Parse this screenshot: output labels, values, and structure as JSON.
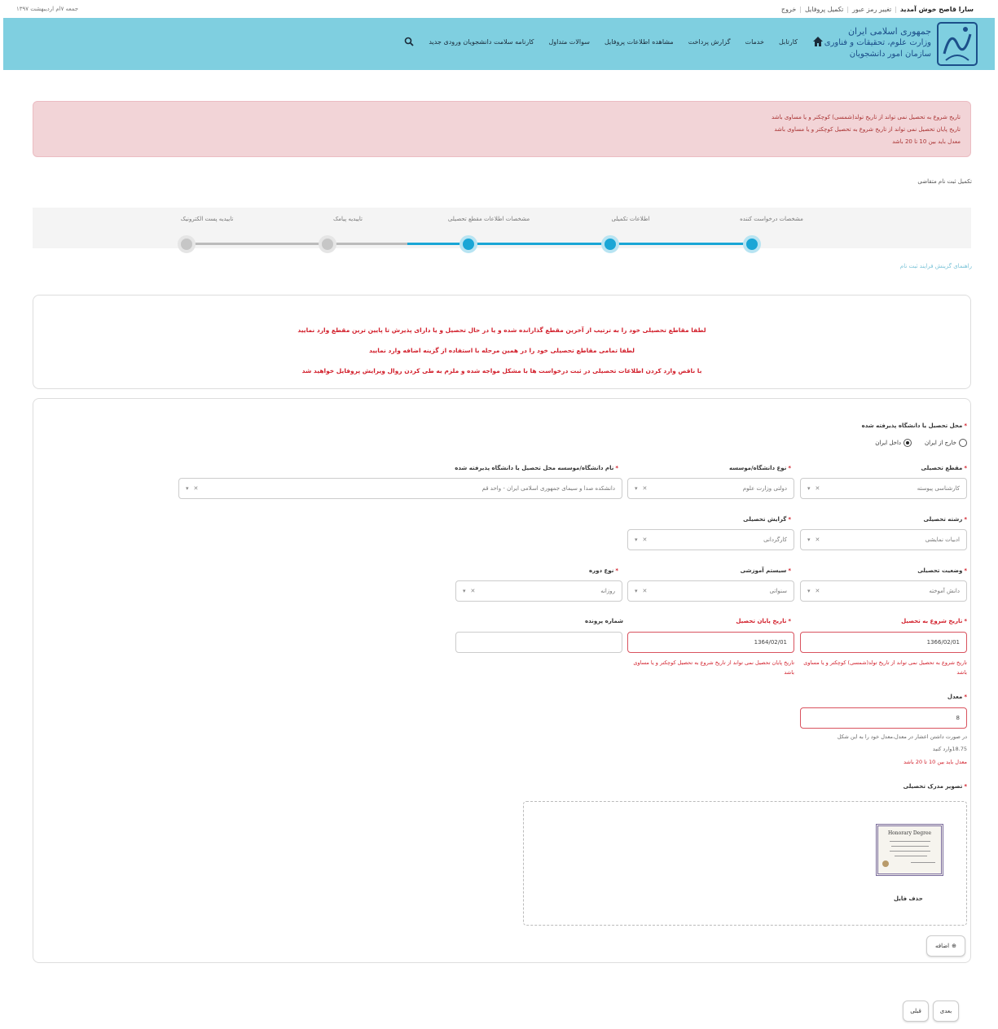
{
  "topbar": {
    "welcome": "سارا قاصح خوش آمدید",
    "change_password": "تغییر رمز عبور",
    "complete_profile": "تکمیل پروفایل",
    "logout": "خروج",
    "date": "جمعه ۷ام اردیبهشت ۱۳۹۷"
  },
  "header": {
    "logo_line1": "جمهوری اسلامی ایران",
    "logo_line2": "وزارت علوم، تحقیقات و فناوری",
    "logo_line3": "سازمان امور دانشجویان",
    "nav": [
      "کارتابل",
      "خدمات",
      "گزارش پرداخت",
      "مشاهده اطلاعات پروفایل",
      "سوالات متداول",
      "کارنامه سلامت دانشجویان ورودی جدید"
    ]
  },
  "alert": {
    "lines": [
      "تاریخ شروع به تحصیل نمی تواند از تاریخ تولد(شمسی) کوچکتر و یا مساوی باشد",
      "تاریخ پایان تحصیل نمی تواند از تاریخ شروع به تحصیل کوچکتر و یا مساوی باشد",
      "معدل باید بین 10 تا 20 باشد"
    ]
  },
  "breadcrumb": "تکمیل ثبت نام متقاضی",
  "stepper": {
    "steps": [
      {
        "label": "مشخصات درخواست کننده",
        "done": true
      },
      {
        "label": "اطلاعات تکمیلی",
        "done": true
      },
      {
        "label": "مشخصات اطلاعات مقطع تحصیلی",
        "done": true
      },
      {
        "label": "تاییدیه پیامک",
        "done": false
      },
      {
        "label": "تاییدیه پست الکترونیک",
        "done": false
      }
    ]
  },
  "guide_link": "راهنمای گزینش فرایند ثبت نام",
  "notice": {
    "lines": [
      "لطفا مقاطع تحصیلی خود را به ترتیب از آخرین مقطع گذارانده شده و یا در حال تحصیل و یا دارای پذیرش تا پایین ترین مقطع وارد نمایید",
      "لطفا تمامی مقاطع تحصیلی خود را در همین مرحله با استفاده از گزینه اضافه وارد نمایید",
      "با ناقص وارد کردن اطلاعات تحصیلی در ثبت درخواست ها با مشکل مواجه شده و ملزم به طی کردن روال ویرایش پروفایل خواهید شد"
    ]
  },
  "form": {
    "location_label": "محل تحصیل یا دانشگاه پذیرفته شده",
    "radio_abroad": "خارج از ایران",
    "radio_iran": "داخل ایران",
    "degree_label": "مقطع تحصیلی",
    "degree_value": "کارشناسی پیوسته",
    "uni_type_label": "نوع دانشگاه/موسسه",
    "uni_type_value": "دولتی وزارت علوم",
    "uni_name_label": "نام دانشگاه/موسسه محل تحصیل یا دانشگاه پذیرفته شده",
    "uni_name_value": "دانشکده صدا و سیمای جمهوری اسلامی ایران - واحد قم",
    "field_label": "رشته تحصیلی",
    "field_value": "ادبیات نمایشی",
    "branch_label": "گرایش تحصیلی",
    "branch_value": "کارگردانی",
    "status_label": "وضعیت تحصیلی",
    "status_value": "دانش آموخته",
    "system_label": "سیستم آموزشی",
    "system_value": "سنواتی",
    "course_label": "نوع دوره",
    "course_value": "روزانه",
    "start_label": "تاریخ شروع به تحصیل",
    "start_value": "1366/02/01",
    "start_error": "تاریخ شروع به تحصیل نمی تواند از تاریخ تولد(شمسی) کوچکتر و یا مساوی باشد",
    "end_label": "تاریخ پایان تحصیل",
    "end_value": "1364/02/01",
    "end_error": "تاریخ پایان تحصیل نمی تواند از تاریخ شروع به تحصیل کوچکتر و یا مساوی باشد",
    "file_label": "شماره پرونده",
    "file_value": "",
    "gpa_label": "معدل",
    "gpa_value": "8",
    "gpa_help1": "در صورت داشتن اعشار در معدل،معدل خود را به این شکل",
    "gpa_help2": "18.75وارد کنید",
    "gpa_error": "معدل باید بین 10 تا 20 باشد",
    "doc_label": "تصویر مدرک تحصیلی",
    "thumb_title": "Honorary Degree",
    "delete_file": "حذف فایل",
    "add_button": "اضافه"
  },
  "footer": {
    "next": "بعدی",
    "prev": "قبلی"
  },
  "colors": {
    "header_bg": "#7fcfe0",
    "step_done": "#1aa6d6",
    "error": "#d21f2b",
    "alert_bg": "#f2d4d7"
  }
}
